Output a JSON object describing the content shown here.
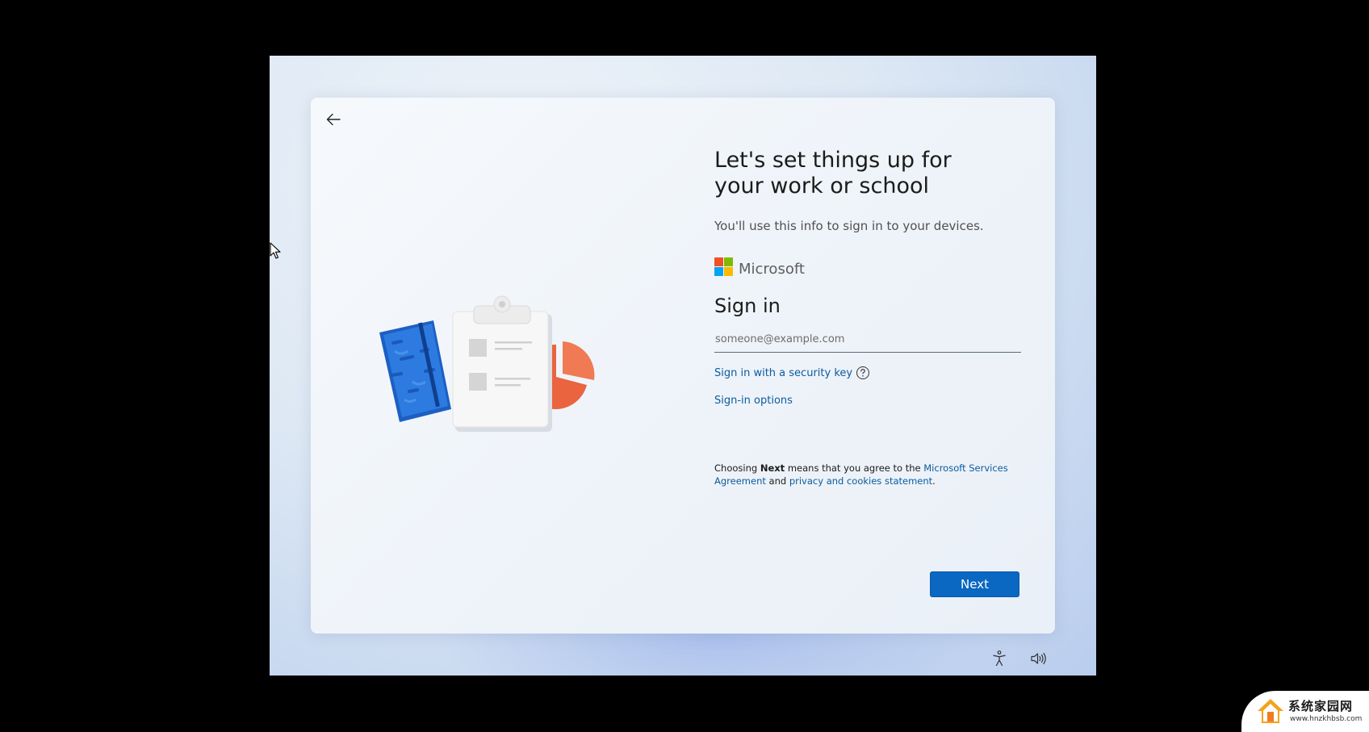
{
  "card": {
    "title": "Let's set things up for your work or school",
    "subtitle": "You'll use this info to sign in to your devices.",
    "brand": "Microsoft",
    "brand_colors": [
      "#f25022",
      "#7fba00",
      "#00a4ef",
      "#ffb900"
    ],
    "signin_heading": "Sign in",
    "email_placeholder": "someone@example.com",
    "email_value": "",
    "security_key_link": "Sign in with a security key",
    "signin_options_link": "Sign-in options",
    "legal": {
      "prefix": "Choosing ",
      "next_word": "Next",
      "middle": " means that you agree to the ",
      "agreement_link": "Microsoft Services Agreement",
      "and": " and ",
      "privacy_link": "privacy and cookies statement",
      "suffix": "."
    },
    "next_button": "Next"
  },
  "colors": {
    "accent": "#0a67c2",
    "link": "#0a5b9e"
  },
  "system_icons": [
    "back-arrow-icon",
    "accessibility-icon",
    "volume-icon",
    "help-icon"
  ],
  "watermark": {
    "title": "系统家园网",
    "url": "www.hnzkhbsb.com"
  }
}
